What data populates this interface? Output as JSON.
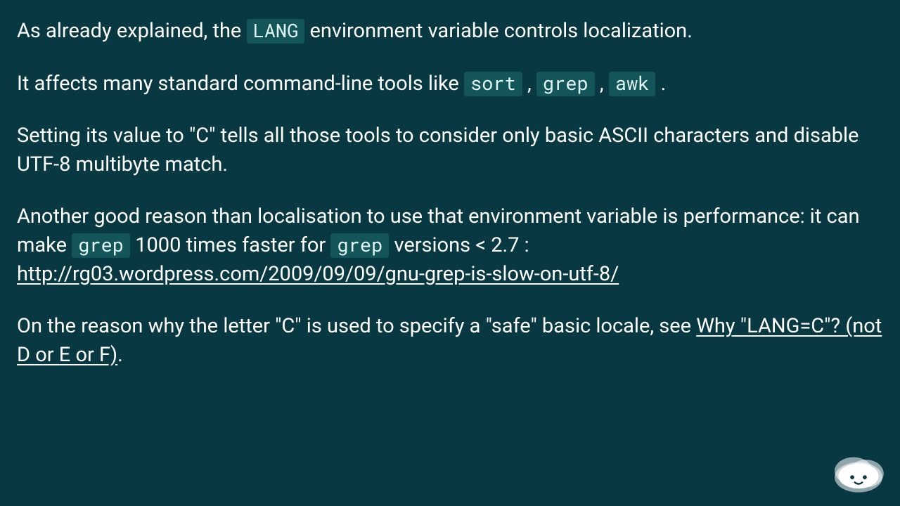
{
  "p1": {
    "t1": "As already explained, the ",
    "code": "LANG",
    "t2": " environment variable controls localization."
  },
  "p2": {
    "t1": "It affects many standard command-line tools like ",
    "code1": "sort",
    "sep1": " , ",
    "code2": "grep",
    "sep2": " , ",
    "code3": "awk",
    "t2": " ."
  },
  "p3": "Setting its value to \"C\" tells all those tools to consider only basic ASCII characters and disable UTF-8 multibyte match.",
  "p4": {
    "t1": "Another good reason than localisation to use that environment variable is performance: it can make ",
    "code1": "grep",
    "t2": " 1000 times faster for ",
    "code2": "grep",
    "t3": " versions < 2.7 : ",
    "link": "http://rg03.wordpress.com/2009/09/09/gnu-grep-is-slow-on-utf-8/"
  },
  "p5": {
    "t1": "On the reason why the letter \"C\" is used to specify a \"safe\" basic locale, see ",
    "link": "Why \"LANG=C\"? (not D or E or F)",
    "t2": "."
  }
}
